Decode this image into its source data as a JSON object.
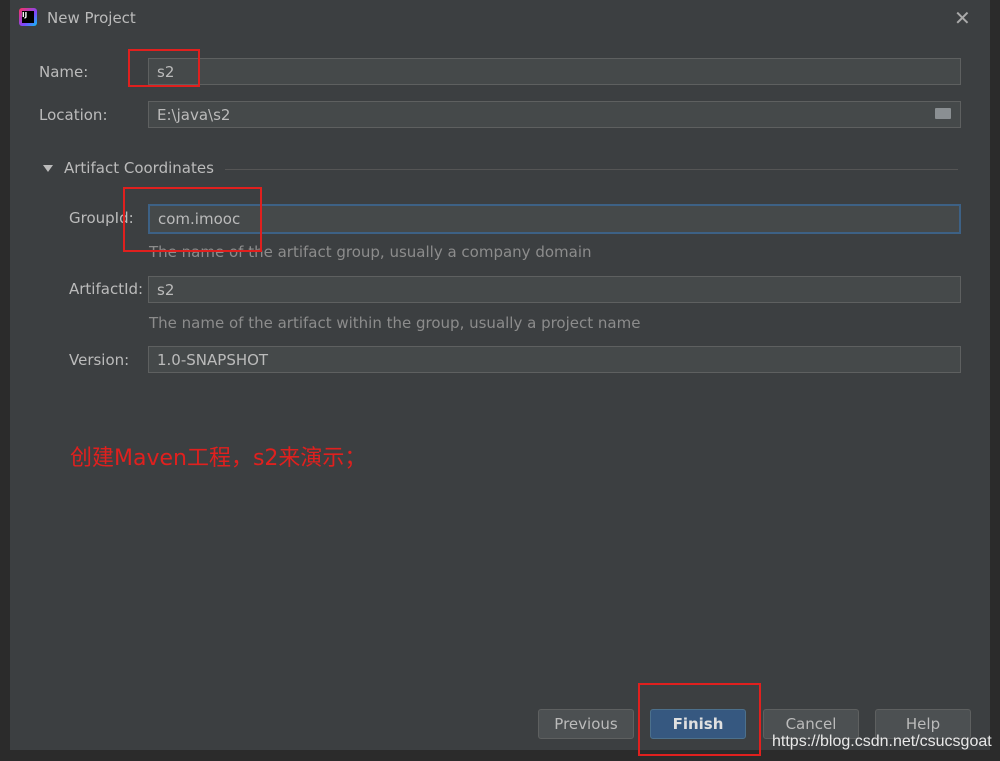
{
  "title": "New Project",
  "name": {
    "label": "Name:",
    "value": "s2"
  },
  "location": {
    "label": "Location:",
    "value": "E:\\java\\s2"
  },
  "section": "Artifact Coordinates",
  "group": {
    "label": "GroupId:",
    "value": "com.imooc",
    "hint": "The name of the artifact group, usually a company domain"
  },
  "artifact": {
    "label": "ArtifactId:",
    "value": "s2",
    "hint": "The name of the artifact within the group, usually a project name"
  },
  "version": {
    "label": "Version:",
    "value": "1.0-SNAPSHOT"
  },
  "annotation": "创建Maven工程，s2来演示；",
  "buttons": {
    "previous": "Previous",
    "finish": "Finish",
    "cancel": "Cancel",
    "help": "Help"
  },
  "watermark": "https://blog.csdn.net/csucsgoat"
}
